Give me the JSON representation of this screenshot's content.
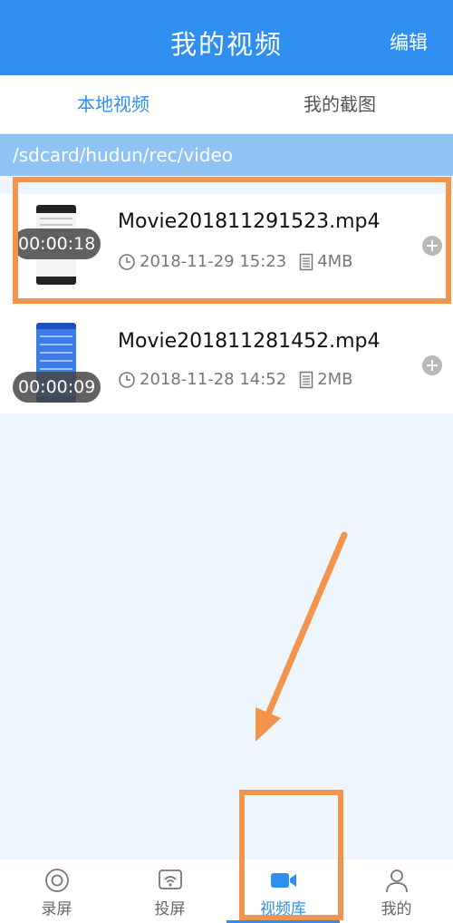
{
  "header": {
    "title": "我的视频",
    "edit_label": "编辑"
  },
  "tabs": [
    {
      "label": "本地视频",
      "active": true
    },
    {
      "label": "我的截图",
      "active": false
    }
  ],
  "path": "/sdcard/hudun/rec/video",
  "videos": [
    {
      "name": "Movie201811291523.mp4",
      "duration": "00:00:18",
      "datetime": "2018-11-29 15:23",
      "size": "4MB",
      "thumb": "light"
    },
    {
      "name": "Movie201811281452.mp4",
      "duration": "00:00:09",
      "datetime": "2018-11-28 14:52",
      "size": "2MB",
      "thumb": "blue"
    }
  ],
  "bottom_nav": [
    {
      "label": "录屏",
      "icon": "record-icon",
      "active": false
    },
    {
      "label": "投屏",
      "icon": "cast-icon",
      "active": false
    },
    {
      "label": "视频库",
      "icon": "video-camera-icon",
      "active": true
    },
    {
      "label": "我的",
      "icon": "person-icon",
      "active": false
    }
  ],
  "colors": {
    "primary": "#2f8ff0",
    "annotation": "#f2944c",
    "path_bar": "#8fc3f4"
  }
}
